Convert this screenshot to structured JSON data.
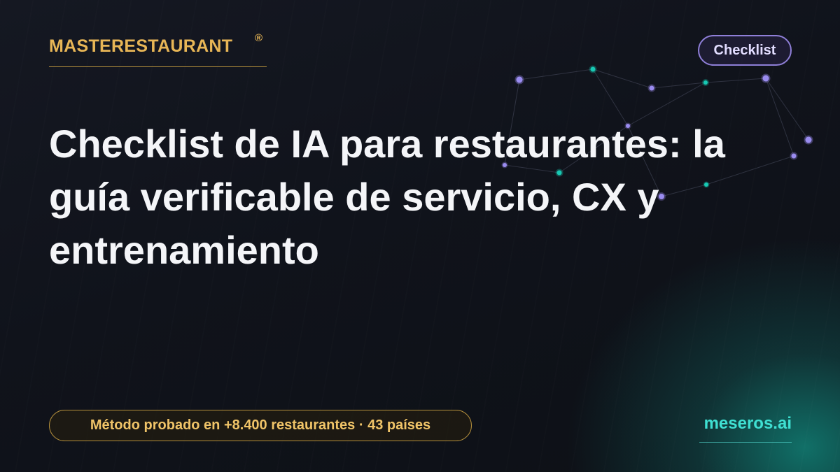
{
  "brand": {
    "name": "MASTERESTAURANT",
    "registered_mark": "®"
  },
  "tag": "Checklist",
  "headline": "Checklist de IA para restaurantes: la guía verificable de servicio, CX y entrenamiento",
  "proof_badge": "Método probado en +8.400 restaurantes · 43 países",
  "site": "meseros.ai",
  "colors": {
    "background": "#0f1119",
    "brand_gold": "#e8b656",
    "chip_purple": "#8f7fd8",
    "accent_teal": "#3fe0d2",
    "node_purple": "#9a8cf0",
    "node_teal": "#18c9b4"
  }
}
